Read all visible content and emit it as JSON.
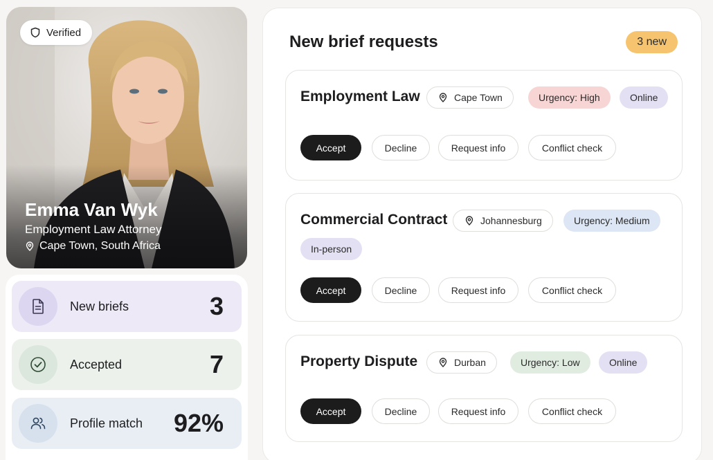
{
  "profile": {
    "verified_label": "Verified",
    "name": "Emma Van Wyk",
    "title": "Employment Law Attorney",
    "location": "Cape Town, South Africa"
  },
  "stats": [
    {
      "label": "New briefs",
      "value": "3",
      "icon": "document-icon"
    },
    {
      "label": "Accepted",
      "value": "7",
      "icon": "check-circle-icon"
    },
    {
      "label": "Profile match",
      "value": "92%",
      "icon": "users-icon"
    }
  ],
  "requests": {
    "title": "New brief requests",
    "new_badge": "3 new",
    "items": [
      {
        "title": "Employment Law",
        "location": "Cape Town",
        "urgency": "Urgency: High",
        "mode": "Online",
        "actions": {
          "accept": "Accept",
          "decline": "Decline",
          "info": "Request info",
          "conflict": "Conflict check"
        }
      },
      {
        "title": "Commercial Contract",
        "location": "Johannesburg",
        "urgency": "Urgency: Medium",
        "mode": "In-person",
        "actions": {
          "accept": "Accept",
          "decline": "Decline",
          "info": "Request info",
          "conflict": "Conflict check"
        }
      },
      {
        "title": "Property Dispute",
        "location": "Durban",
        "urgency": "Urgency: Low",
        "mode": "Online",
        "actions": {
          "accept": "Accept",
          "decline": "Decline",
          "info": "Request info",
          "conflict": "Conflict check"
        }
      }
    ]
  },
  "colors": {
    "accent_badge": "#f6c46f",
    "urgency_high": "#f6d5d4",
    "urgency_medium": "#dde6f4",
    "urgency_low": "#e1ece1",
    "mode_chip": "#e4e0f4",
    "accept_button": "#1c1c1c"
  }
}
